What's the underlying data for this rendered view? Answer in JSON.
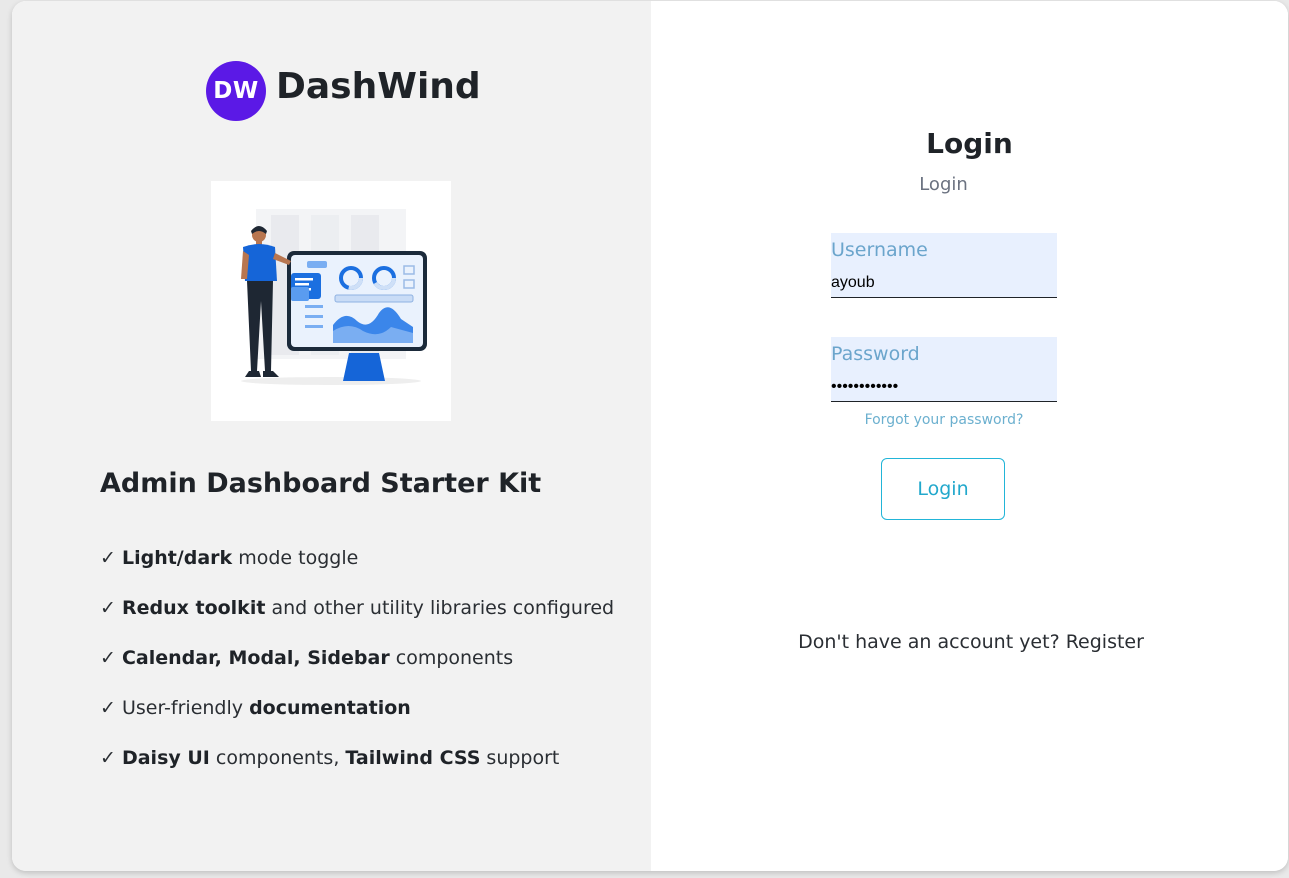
{
  "brand": {
    "badge": "DW",
    "name": "DashWind",
    "accent": "#5b19e6"
  },
  "left": {
    "title": "Admin Dashboard Starter Kit",
    "check_mark": "✓",
    "features": [
      {
        "parts": [
          {
            "text": "Light/dark",
            "bold": true
          },
          {
            "text": " mode toggle",
            "bold": false
          }
        ]
      },
      {
        "parts": [
          {
            "text": "Redux toolkit",
            "bold": true
          },
          {
            "text": " and other utility libraries configured",
            "bold": false
          }
        ]
      },
      {
        "parts": [
          {
            "text": "Calendar, Modal, Sidebar",
            "bold": true
          },
          {
            "text": " components",
            "bold": false
          }
        ]
      },
      {
        "parts": [
          {
            "text": "User-friendly ",
            "bold": false
          },
          {
            "text": "documentation",
            "bold": true
          }
        ]
      },
      {
        "parts": [
          {
            "text": "Daisy UI",
            "bold": true
          },
          {
            "text": " components, ",
            "bold": false
          },
          {
            "text": "Tailwind CSS",
            "bold": true
          },
          {
            "text": " support",
            "bold": false
          }
        ]
      }
    ]
  },
  "login": {
    "title": "Login",
    "subtitle": "Login",
    "username": {
      "label": "Username",
      "value": "ayoub"
    },
    "password": {
      "label": "Password",
      "value": "••••••••••••"
    },
    "forgot_label": "Forgot your password?",
    "submit_label": "Login",
    "register_prompt": "Don't have an account yet? ",
    "register_link": "Register",
    "button_color": "#22b5d8"
  }
}
